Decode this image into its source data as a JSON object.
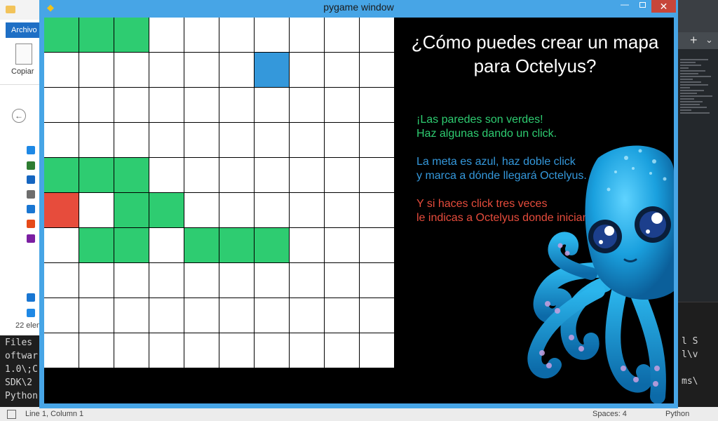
{
  "explorer": {
    "ribbon_tab": "Archivo",
    "copy_label": "Copiar",
    "back_glyph": "←",
    "item_count": "22 elem",
    "nav_icon_colors": [
      "#1e88e5",
      "#2e7d32",
      "#1565c0",
      "#6d6d6d",
      "#1976d2",
      "#e64a19",
      "#7b1fa2"
    ]
  },
  "terminal": {
    "lines": [
      "Files",
      "oftwar",
      "1.0\\;C",
      "SDK\\2",
      "Python"
    ]
  },
  "editor_right": {
    "panel_lines": [
      "l S",
      "l\\v",
      "ms\\"
    ]
  },
  "statusbar": {
    "position": "Line 1, Column 1",
    "spaces": "Spaces: 4",
    "language": "Python"
  },
  "pygame_window": {
    "title": "pygame window",
    "icon": "pygame-icon",
    "minimize_glyph": "—",
    "close_glyph": "✕"
  },
  "board": {
    "rows": 10,
    "cols": 10,
    "colors": {
      "empty": "#ffffff",
      "wall": "#2ecc71",
      "goal": "#3498db",
      "start": "#e74c3c",
      "grid_line": "#000000"
    },
    "walls": [
      [
        0,
        0
      ],
      [
        0,
        1
      ],
      [
        0,
        2
      ],
      [
        4,
        0
      ],
      [
        4,
        1
      ],
      [
        4,
        2
      ],
      [
        5,
        2
      ],
      [
        5,
        3
      ],
      [
        6,
        1
      ],
      [
        6,
        2
      ],
      [
        6,
        4
      ],
      [
        6,
        5
      ],
      [
        6,
        6
      ]
    ],
    "goal": [
      1,
      6
    ],
    "start": [
      5,
      0
    ]
  },
  "info": {
    "title_line1": "¿Cómo puedes crear un mapa",
    "title_line2": "para Octelyus?",
    "walls_line1": "¡Las paredes son verdes!",
    "walls_line2": "Haz algunas dando un click.",
    "goal_line1": "La meta es azul, haz doble click",
    "goal_line2": "y marca a dónde llegará Octelyus.",
    "start_line1": "Y si haces click tres veces",
    "start_line2": "le indicas a Octelyus donde iniciar",
    "colors": {
      "title": "#ffffff",
      "walls": "#2ecc71",
      "goal": "#3498db",
      "start": "#e74c3c"
    }
  },
  "mascot": {
    "icon": "octopus-mascot",
    "body_color": "#19a3e0",
    "sucker_color": "#b98ad6"
  }
}
